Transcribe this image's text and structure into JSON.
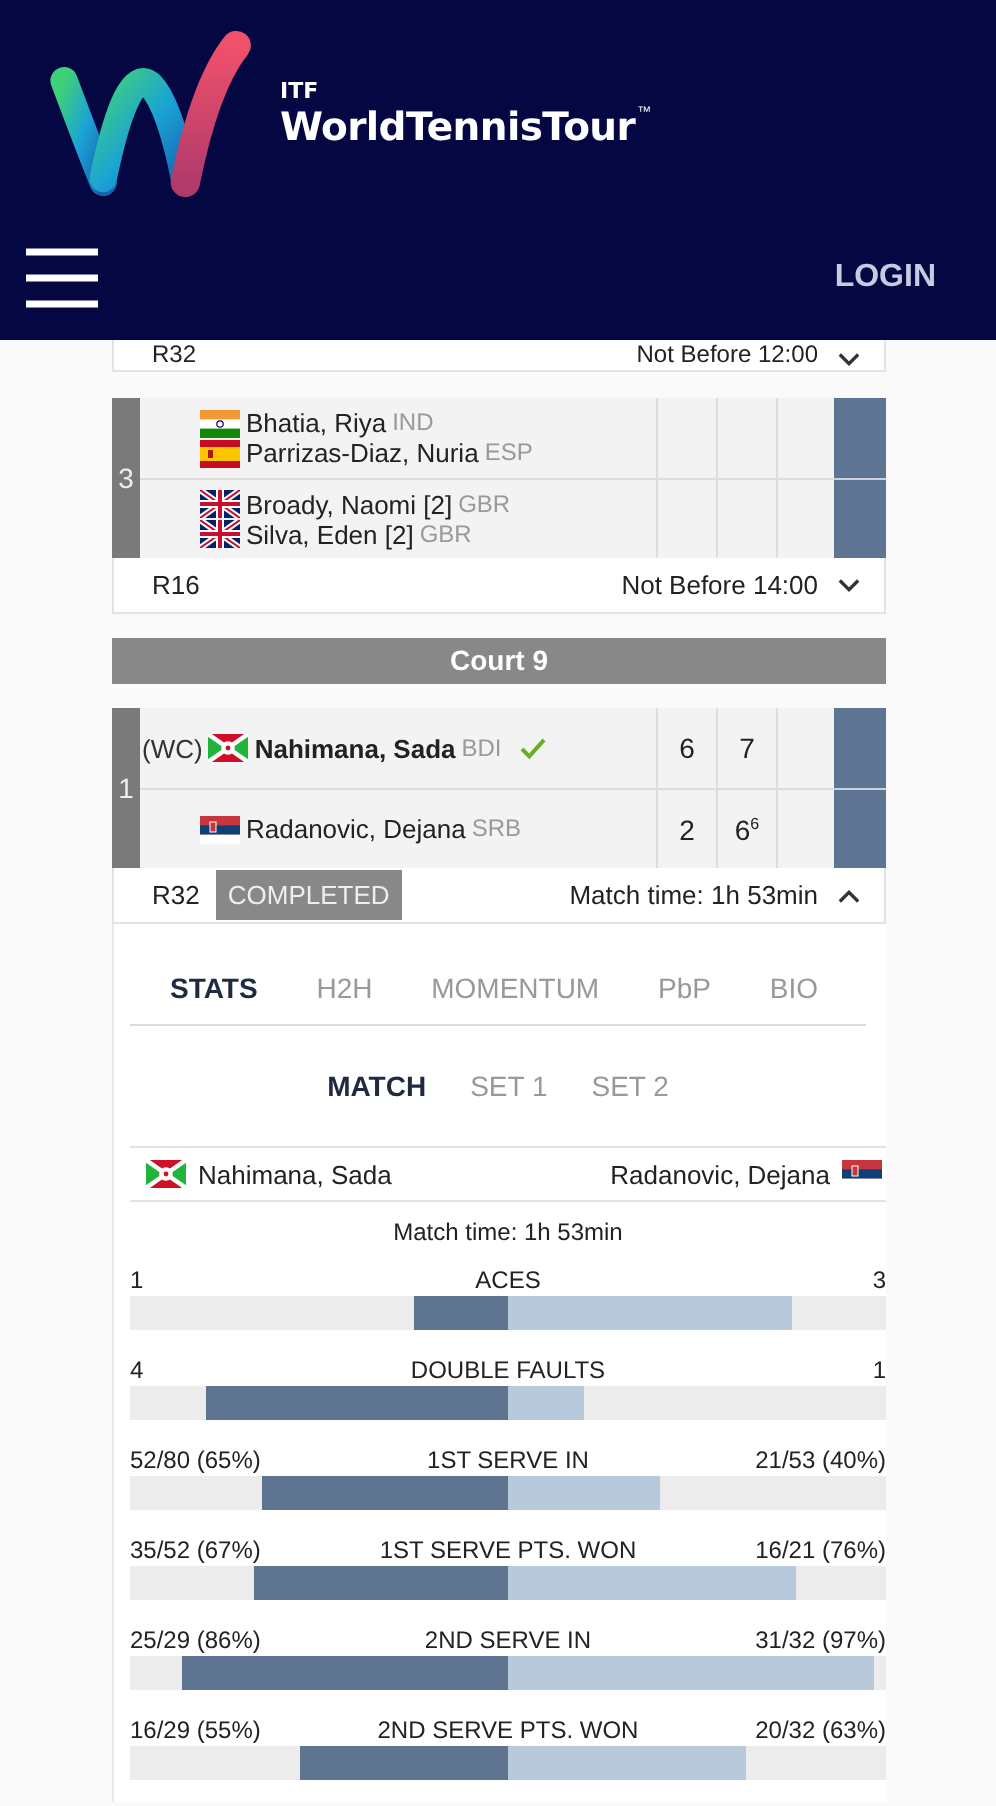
{
  "header": {
    "brand_small": "ITF",
    "brand": "WorldTennisTour",
    "trademark": "™",
    "login": "LOGIN"
  },
  "top_row": {
    "round": "R32",
    "time": "Not Before 12:00",
    "expanded": false
  },
  "matches": [
    {
      "number": "3",
      "teams": [
        {
          "winner": false,
          "players": [
            {
              "name": "Bhatia, Riya",
              "country": "IND",
              "kind": "ind"
            },
            {
              "name": "Parrizas-Diaz, Nuria",
              "country": "ESP",
              "kind": "esp"
            }
          ]
        },
        {
          "winner": false,
          "players": [
            {
              "name": "Broady, Naomi [2]",
              "country": "GBR",
              "kind": "gbr"
            },
            {
              "name": "Silva, Eden [2]",
              "country": "GBR",
              "kind": "gbr"
            }
          ]
        }
      ],
      "round": "R16",
      "time": "Not Before 14:00",
      "expanded": false
    },
    {
      "number": "1",
      "court": "Court 9",
      "teams": [
        {
          "entry": "(WC)",
          "winner": true,
          "players": [
            {
              "name": "Nahimana, Sada",
              "country": "BDI",
              "kind": "bdi"
            }
          ],
          "scores": [
            "6",
            "7"
          ]
        },
        {
          "winner": false,
          "players": [
            {
              "name": "Radanovic, Dejana",
              "country": "SRB",
              "kind": "srb"
            }
          ],
          "scores": [
            "2",
            "6$^{6}$"
          ]
        }
      ],
      "round": "R32",
      "status": "COMPLETED",
      "time": "Match time: 1h 53min",
      "expanded": true
    }
  ],
  "stats_panel": {
    "tabs": [
      {
        "label": "STATS",
        "selected": true
      },
      {
        "label": "H2H",
        "selected": false
      },
      {
        "label": "MOMENTUM",
        "selected": false
      },
      {
        "label": "PbP",
        "selected": false
      },
      {
        "label": "BIO",
        "selected": false
      }
    ],
    "sets": [
      {
        "label": "MATCH",
        "selected": true
      },
      {
        "label": "SET 1",
        "selected": false
      },
      {
        "label": "SET 2",
        "selected": false
      }
    ],
    "home": {
      "name": "Nahimana, Sada",
      "kind": "bdi"
    },
    "away": {
      "name": "Radanovic, Dejana",
      "kind": "srb"
    },
    "match_time": "Match time: 1h 53min",
    "stats": [
      {
        "label": "ACES",
        "home": {
          "value": "1",
          "level": 0.25
        },
        "away": {
          "value": "3",
          "level": 0.75
        }
      },
      {
        "label": "DOUBLE FAULTS",
        "home": {
          "value": "4",
          "level": 0.8
        },
        "away": {
          "value": "1",
          "level": 0.2
        }
      },
      {
        "label": "1ST SERVE IN",
        "home": {
          "value": "52/80 (65%)",
          "level": 0.65
        },
        "away": {
          "value": "21/53 (40%)",
          "level": 0.4
        }
      },
      {
        "label": "1ST SERVE PTS. WON",
        "home": {
          "value": "35/52 (67%)",
          "level": 0.67
        },
        "away": {
          "value": "16/21 (76%)",
          "level": 0.76
        }
      },
      {
        "label": "2ND SERVE IN",
        "home": {
          "value": "25/29 (86%)",
          "level": 0.86
        },
        "away": {
          "value": "31/32 (97%)",
          "level": 0.97
        }
      },
      {
        "label": "2ND SERVE PTS. WON",
        "home": {
          "value": "16/29 (55%)",
          "level": 0.55
        },
        "away": {
          "value": "20/32 (63%)",
          "level": 0.63
        }
      }
    ]
  }
}
